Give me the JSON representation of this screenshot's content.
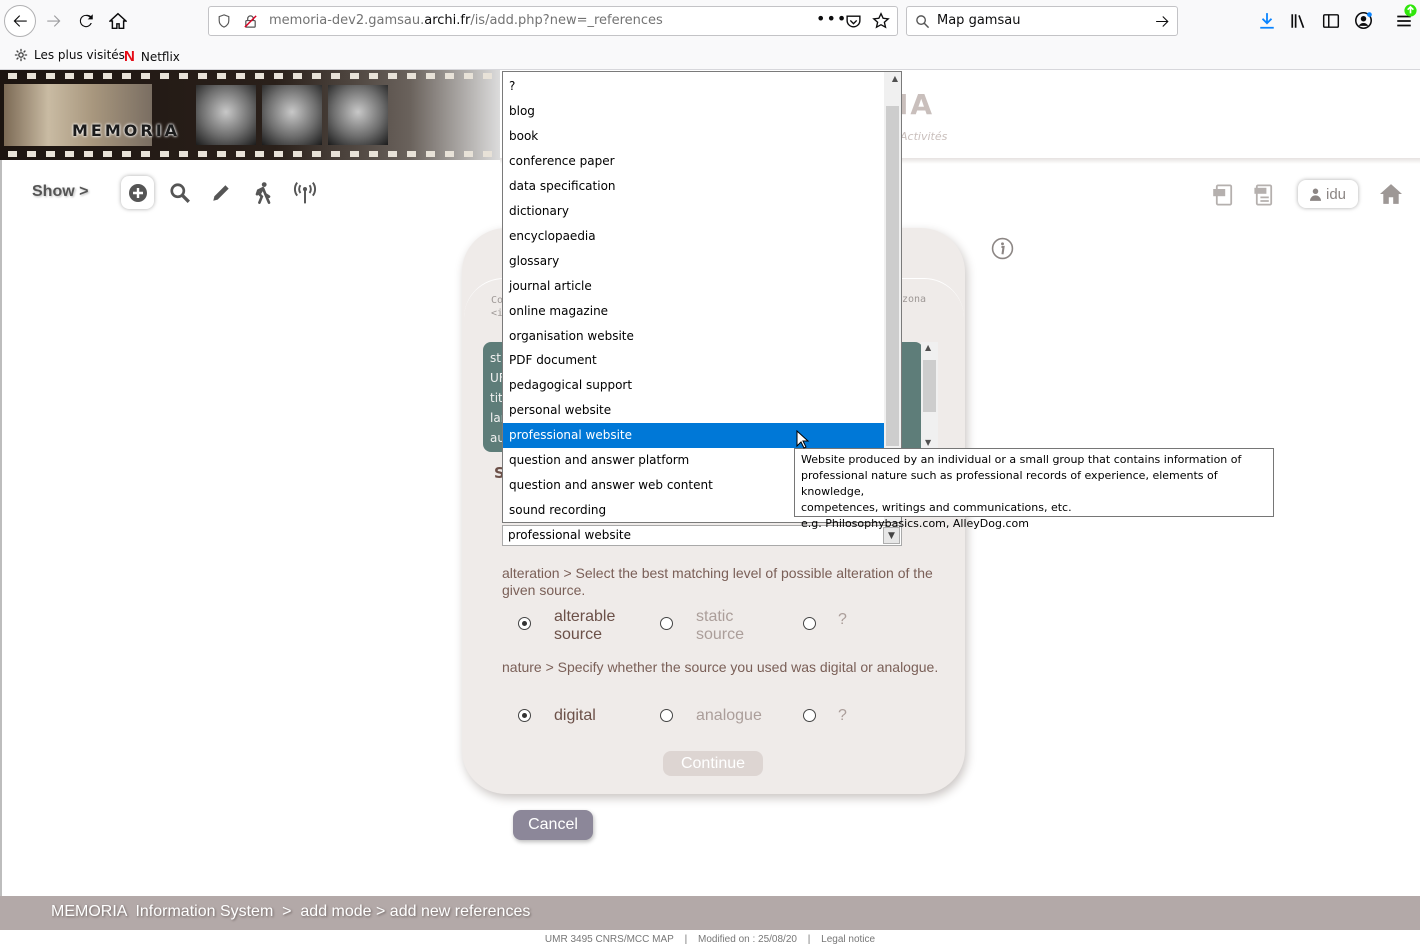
{
  "browser": {
    "url_prefix": "memoria-dev2.gamsau.",
    "url_domain": "archi.fr",
    "url_path": "/is/add.php?new=_references",
    "search_text": "Map gamsau",
    "bookmarks": [
      "Les plus visités",
      "Netflix"
    ]
  },
  "header": {
    "logo_text": "MEMORIA",
    "title_fragment": "IA",
    "subtitle_fragment": "Activités"
  },
  "nav": {
    "show_label": "Show >",
    "user_label": "idu"
  },
  "form": {
    "fragment_left": "Co\n<i",
    "fragment_right": "zona",
    "teal_lines": [
      "st",
      "UF",
      "tit",
      "lar",
      "au"
    ],
    "section_fragment": "S",
    "select_value": "professional website",
    "alteration": {
      "question": "alteration > Select the best matching level of possible alteration of the given source.",
      "options": [
        "alterable source",
        "static source",
        "?"
      ],
      "selected": 0
    },
    "nature": {
      "question": "nature > Specify whether the source you used was digital or analogue.",
      "options": [
        "digital",
        "analogue",
        "?"
      ],
      "selected": 0
    },
    "continue_label": "Continue",
    "cancel_label": "Cancel"
  },
  "dropdown": {
    "options": [
      "?",
      "blog",
      "book",
      "conference paper",
      "data specification",
      "dictionary",
      "encyclopaedia",
      "glossary",
      "journal article",
      "online magazine",
      "organisation website",
      "PDF document",
      "pedagogical support",
      "personal website",
      "professional website",
      "question and answer platform",
      "question and answer web content",
      "sound recording"
    ],
    "highlighted_index": 14
  },
  "tooltip": {
    "lines": [
      "Website produced by an individual or a small group that contains information of",
      "professional nature such as professional records of experience, elements of knowledge,",
      "competences, writings and communications, etc.",
      "e.g. Philosophybasics.com, AlleyDog.com"
    ]
  },
  "footer": {
    "crumbs": "MEMORIA  Information System  >  add mode > add new references",
    "credit": "UMR 3495 CNRS/MCC MAP",
    "modified": "Modified on : 25/08/20",
    "legal": "Legal notice",
    "separator": "|"
  },
  "colors": {
    "panel": "#efebe9",
    "teal": "#5e7d79",
    "highlight": "#0078d7",
    "footer": "#b3a9a8",
    "cancel": "#8c8799"
  }
}
